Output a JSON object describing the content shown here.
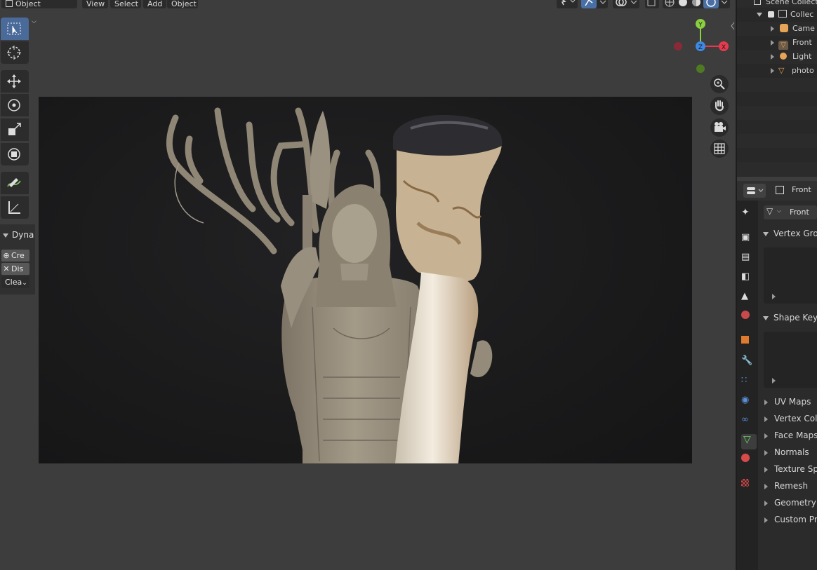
{
  "header": {
    "mode_label": "Object Mode",
    "menu_view": "View",
    "menu_select": "Select",
    "menu_add": "Add",
    "menu_object": "Object"
  },
  "toolbar": {
    "tools": [
      "select-box",
      "cursor",
      "move",
      "rotate",
      "scale",
      "transform",
      "annotate",
      "measure"
    ]
  },
  "dynamic_panel": {
    "title": "Dyna",
    "create_label": "Cre",
    "dissolve_label": "Dis",
    "clear_label": "Clea"
  },
  "gizmo": {
    "x_label": "X",
    "y_label": "Y",
    "z_label": "Z",
    "colors": {
      "x": "#e63a4f",
      "y": "#8bd040",
      "z": "#3d8ae6"
    }
  },
  "outliner": {
    "scene_collection": "Scene Collect",
    "collection": "Collec",
    "items": [
      "Came",
      "Front",
      "Light",
      "photo"
    ]
  },
  "properties": {
    "header_object": "Front",
    "mesh_name": "Front",
    "sections": {
      "vertex_groups": "Vertex Grou",
      "shape_keys": "Shape Keys",
      "uv_maps": "UV Maps",
      "vertex_colors": "Vertex Colo",
      "face_maps": "Face Maps",
      "normals": "Normals",
      "texture_space": "Texture Spa",
      "remesh": "Remesh",
      "geometry_data": "Geometry D",
      "custom_props": "Custom Pro"
    }
  }
}
